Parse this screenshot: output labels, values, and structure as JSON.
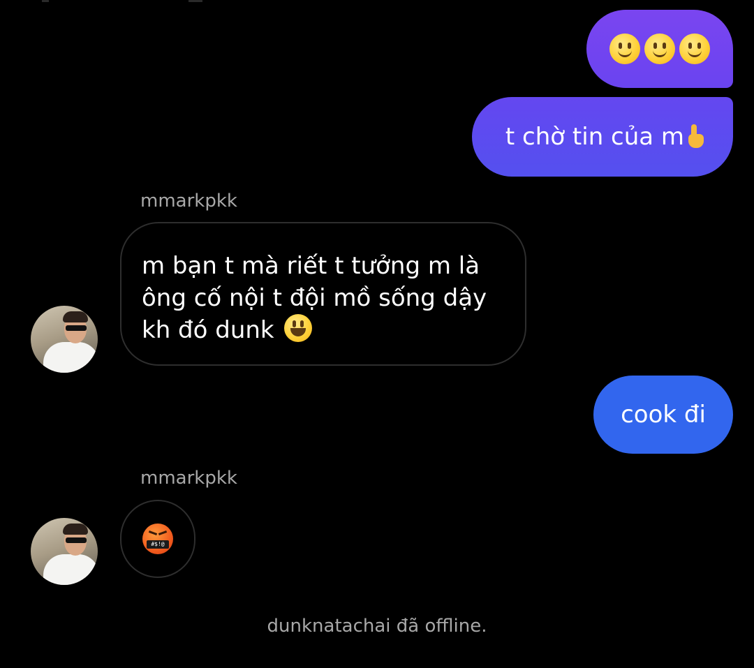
{
  "colors": {
    "background": "#000000",
    "outgoing_gradient_top": "#7a45f0",
    "outgoing_gradient_bottom": "#3365ee",
    "incoming_border": "#2e2e2e",
    "muted_text": "#a8a8a8"
  },
  "messages": [
    {
      "direction": "outgoing",
      "text": "",
      "emojis": [
        "slightly-smiling-face",
        "slightly-smiling-face",
        "slightly-smiling-face"
      ],
      "color": "#7244f0"
    },
    {
      "direction": "outgoing",
      "text": "t chờ tin của m",
      "emojis": [
        "pointing-up-hand"
      ],
      "color": "#5b4cf0"
    },
    {
      "direction": "incoming",
      "sender": "mmarkpkk",
      "lines": [
        "m bạn t mà riết t tưởng m là",
        "ông cố nội t đội mồ sống dậy",
        "kh đó dunk"
      ],
      "emojis": [
        "grinning-face"
      ]
    },
    {
      "direction": "outgoing",
      "text": "cook đi",
      "color": "#3266ee"
    },
    {
      "direction": "incoming",
      "sender": "mmarkpkk",
      "text": "",
      "emojis": [
        "face-with-symbols-on-mouth"
      ]
    }
  ],
  "emoji_text": {
    "symbols_bar": "#$!@"
  },
  "status": "dunknatachai đã offline."
}
